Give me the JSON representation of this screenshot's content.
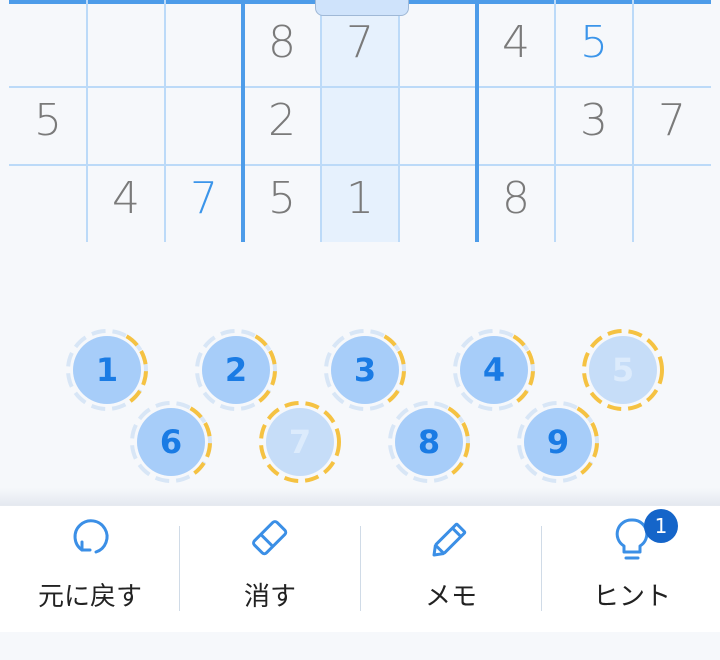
{
  "grid": {
    "rows": [
      [
        "",
        "",
        "",
        "8",
        "7",
        "",
        "4",
        "5",
        ""
      ],
      [
        "5",
        "",
        "",
        "2",
        "",
        "",
        "",
        "3",
        "7"
      ],
      [
        "",
        "4",
        "7",
        "5",
        "1",
        "",
        "8",
        "",
        ""
      ]
    ],
    "user_cells": [
      "0-7",
      "2-2"
    ]
  },
  "numbers": [
    {
      "value": "1",
      "faded": false,
      "ring": "mixed"
    },
    {
      "value": "2",
      "faded": false,
      "ring": "mixed"
    },
    {
      "value": "3",
      "faded": false,
      "ring": "mixed"
    },
    {
      "value": "4",
      "faded": false,
      "ring": "mixed"
    },
    {
      "value": "5",
      "faded": true,
      "ring": "yellow"
    },
    {
      "value": "6",
      "faded": false,
      "ring": "mixed"
    },
    {
      "value": "7",
      "faded": true,
      "ring": "yellow"
    },
    {
      "value": "8",
      "faded": false,
      "ring": "mixed"
    },
    {
      "value": "9",
      "faded": false,
      "ring": "mixed"
    }
  ],
  "toolbar": {
    "undo_label": "元に戻す",
    "erase_label": "消す",
    "memo_label": "メモ",
    "hint_label": "ヒント",
    "hint_count": "1"
  },
  "colors": {
    "accent": "#3b95ea",
    "given_digit": "#7a7a7a",
    "badge": "#1565c9",
    "ring_yellow": "#f5c242",
    "ring_blue": "#d8e6f6"
  }
}
